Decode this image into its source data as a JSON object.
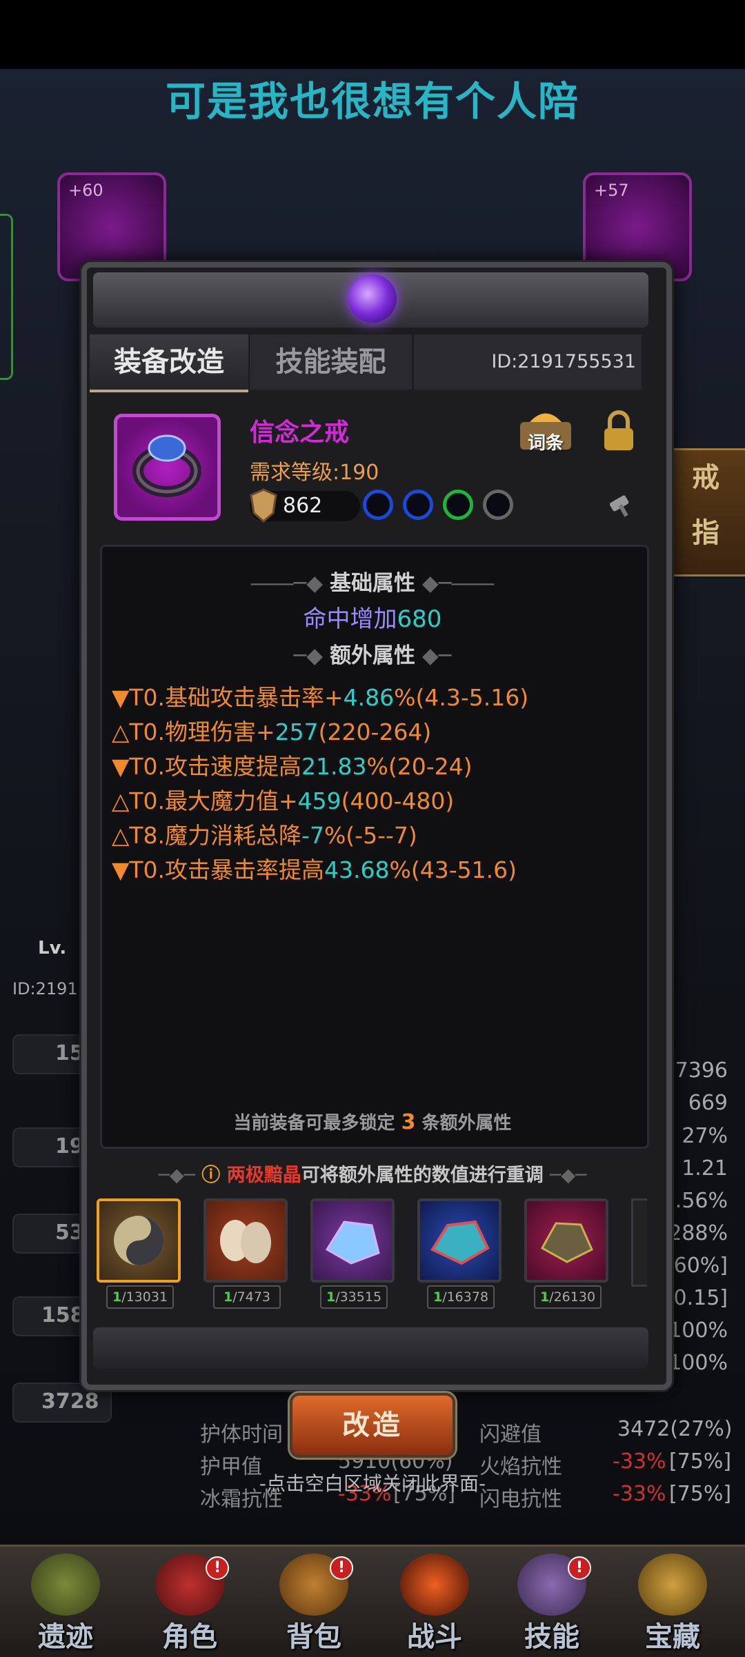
{
  "subtitle": "可是我也很想有个人陪",
  "background": {
    "slot_levels": [
      "+60",
      "+57"
    ],
    "side_tab": [
      "戒",
      "指"
    ],
    "char_level": "Lv.",
    "char_id": "ID:2191",
    "left_stats": [
      "15",
      "19",
      "53",
      "158",
      "3728"
    ],
    "right_stats": [
      "27396",
      "669",
      "27%",
      "1.21",
      "2.56%",
      "288%",
      "[60%]",
      "[0.15]",
      "100%",
      "100%"
    ],
    "rows": [
      {
        "l1": "护体时间",
        "l2": "闪避值",
        "v2": "3472(27%)"
      },
      {
        "l1": "护甲值",
        "v1": "5910(60%)",
        "l2": "火焰抗性",
        "v2a": "-33%",
        "v2b": "[75%]"
      },
      {
        "l1": "冰霜抗性",
        "v1": "-33%",
        "v1b": "[75%]",
        "l2": "闪电抗性",
        "v2a": "-33%",
        "v2b": "[75%]"
      }
    ]
  },
  "tabs": {
    "reforge": "装备改造",
    "skill": "技能装配"
  },
  "id_label": "ID:2191755531",
  "item": {
    "name": "信念之戒",
    "required_level": "需求等级:190",
    "score": "862",
    "affix_button": "词条",
    "socket_colors": [
      "#1a4ad8",
      "#1a4ad8",
      "#1ab83a",
      "#666666"
    ]
  },
  "base_section_title": "基础属性",
  "base_attr": {
    "label": "命中增加",
    "value": "680"
  },
  "extra_section_title": "额外属性",
  "extra_attrs": [
    {
      "prefix": "▼T0.基础攻击暴击率+",
      "value": "4.86",
      "suffix": "%(4.3-5.16)"
    },
    {
      "prefix": "△T0.物理伤害+",
      "value": "257",
      "suffix": "(220-264)"
    },
    {
      "prefix": "▼T0.攻击速度提高",
      "value": "21.83",
      "suffix": "%(20-24)"
    },
    {
      "prefix": "△T0.最大魔力值+",
      "value": "459",
      "suffix": "(400-480)"
    },
    {
      "prefix": "△T8.魔力消耗总降",
      "value": "-7",
      "suffix": "%(-5--7)"
    },
    {
      "prefix": "▼T0.攻击暴击率提高",
      "value": "43.68",
      "suffix": "%(43-51.6)"
    }
  ],
  "lock_hint": {
    "pre": "当前装备可最多锁定",
    "num": "3",
    "post": "条额外属性"
  },
  "material_hint": {
    "highlight": "两极黯晶",
    "rest": "可将额外属性的数值进行重调"
  },
  "materials": [
    {
      "have": "1",
      "total": "/13031"
    },
    {
      "have": "1",
      "total": "/7473"
    },
    {
      "have": "1",
      "total": "/33515"
    },
    {
      "have": "1",
      "total": "/16378"
    },
    {
      "have": "1",
      "total": "/26130"
    }
  ],
  "reforge_button": "改造",
  "close_hint": "-点击空白区域关闭此界面-",
  "nav": [
    "遗迹",
    "角色",
    "背包",
    "战斗",
    "技能",
    "宝藏"
  ],
  "nav_badge": "!"
}
